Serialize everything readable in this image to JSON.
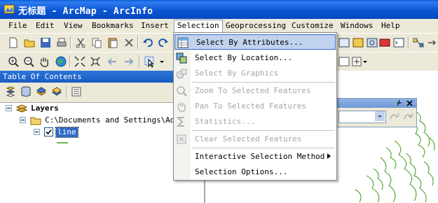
{
  "window": {
    "title": "无标题 - ArcMap - ArcInfo"
  },
  "menubar": {
    "items": [
      {
        "label": "File"
      },
      {
        "label": "Edit"
      },
      {
        "label": "View"
      },
      {
        "label": "Bookmarks"
      },
      {
        "label": "Insert"
      },
      {
        "label": "Selection"
      },
      {
        "label": "Geoprocessing"
      },
      {
        "label": "Customize"
      },
      {
        "label": "Windows"
      },
      {
        "label": "Help"
      }
    ],
    "active": "Selection"
  },
  "toc": {
    "title": "Table Of Contents",
    "layers_label": "Layers",
    "folder_path": "C:\\Documents and Settings\\Admin",
    "layer_name": "line"
  },
  "selection_menu": {
    "items": [
      {
        "label": "Select By Attributes...",
        "enabled": true,
        "highlighted": true
      },
      {
        "label": "Select By Location...",
        "enabled": true
      },
      {
        "label": "Select By Graphics",
        "enabled": false
      },
      {
        "label": "Zoom To Selected Features",
        "enabled": false
      },
      {
        "label": "Pan To Selected Features",
        "enabled": false
      },
      {
        "label": "Statistics...",
        "enabled": false
      },
      {
        "label": "Clear Selected Features",
        "enabled": false
      },
      {
        "label": "Interactive Selection Method",
        "enabled": true,
        "submenu": true
      },
      {
        "label": "Selection Options...",
        "enabled": true
      }
    ]
  },
  "colors": {
    "titlebar": "#0b55d3",
    "highlight": "#c1d2ee",
    "highlight_border": "#316ac5",
    "map_lines": "#3a9a12"
  }
}
